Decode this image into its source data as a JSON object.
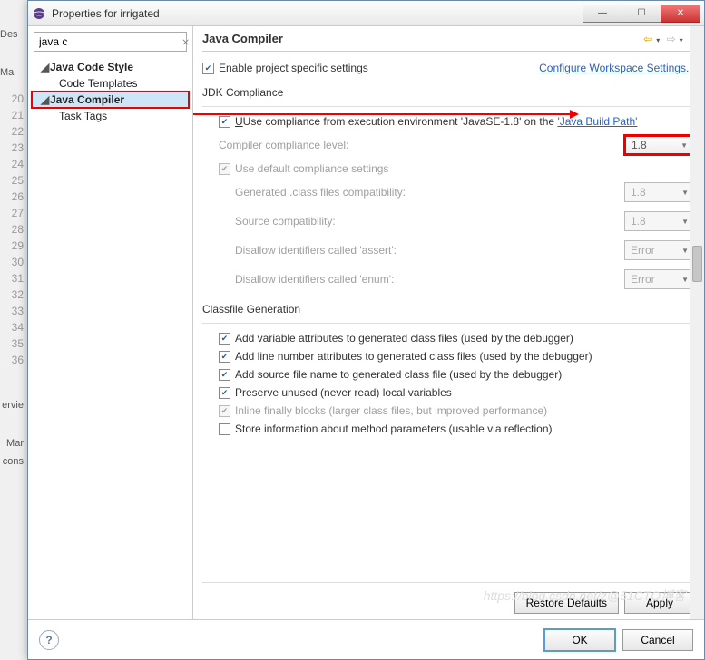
{
  "bg": {
    "tabs": [
      "Des",
      "",
      "Mai"
    ],
    "lines": [
      "20",
      "21",
      "22",
      "23",
      "24",
      "25",
      "26",
      "27",
      "28",
      "29",
      "30",
      "31",
      "32",
      "33",
      "34",
      "35",
      "36"
    ],
    "views": [
      "ervie",
      "",
      "Mar",
      "cons"
    ]
  },
  "window": {
    "title": "Properties for irrigated",
    "min": "—",
    "max": "☐",
    "close": "✕"
  },
  "filter": {
    "value": "java c",
    "clear": "⨯"
  },
  "tree": {
    "i0": {
      "arrow": "◢",
      "label": "Java Code Style"
    },
    "i1": {
      "label": "Code Templates"
    },
    "i2": {
      "arrow": "◢",
      "label": "Java Compiler"
    },
    "i3": {
      "label": "Task Tags"
    }
  },
  "header": {
    "title": "Java Compiler"
  },
  "top": {
    "enable": "Enable project specific settings",
    "configure": "Configure Workspace Settings..."
  },
  "jdk": {
    "group": "JDK Compliance",
    "useExecEnv_pre": "Use compliance from execution environment 'JavaSE-1.8' on the ",
    "buildPath": "'Java Build Path'",
    "level_lbl": "Compiler compliance level:",
    "level_val": "1.8",
    "useDefault": "Use default compliance settings",
    "gen_lbl": "Generated .class files compatibility:",
    "gen_val": "1.8",
    "src_lbl": "Source compatibility:",
    "src_val": "1.8",
    "assert_lbl": "Disallow identifiers called 'assert':",
    "assert_val": "Error",
    "enum_lbl": "Disallow identifiers called 'enum':",
    "enum_val": "Error"
  },
  "classfile": {
    "group": "Classfile Generation",
    "c1": "Add variable attributes to generated class files (used by the debugger)",
    "c2": "Add line number attributes to generated class files (used by the debugger)",
    "c3": "Add source file name to generated class file (used by the debugger)",
    "c4": "Preserve unused (never read) local variables",
    "c5": "Inline finally blocks (larger class files, but improved performance)",
    "c6": "Store information about method parameters (usable via reflection)"
  },
  "buttons": {
    "restore": "Restore Defaults",
    "apply": "Apply",
    "ok": "OK",
    "cancel": "Cancel",
    "help": "?"
  },
  "watermark": "https://blog.csdn.net/z@51CTO博客"
}
